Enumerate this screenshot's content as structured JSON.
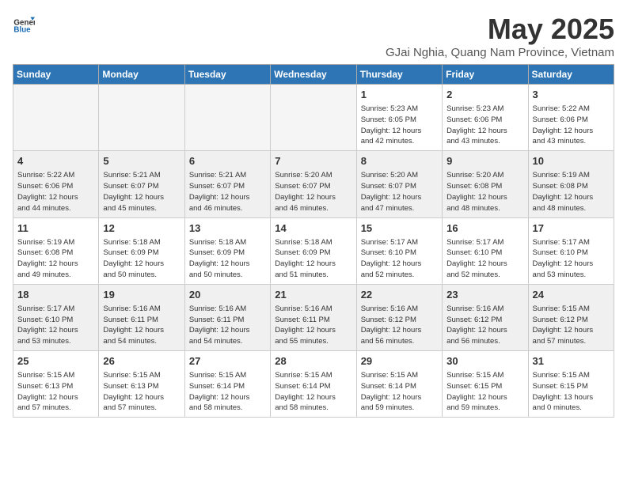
{
  "logo": {
    "general": "General",
    "blue": "Blue"
  },
  "header": {
    "title": "May 2025",
    "subtitle": "GJai Nghia, Quang Nam Province, Vietnam"
  },
  "weekdays": [
    "Sunday",
    "Monday",
    "Tuesday",
    "Wednesday",
    "Thursday",
    "Friday",
    "Saturday"
  ],
  "weeks": [
    [
      {
        "day": "",
        "info": ""
      },
      {
        "day": "",
        "info": ""
      },
      {
        "day": "",
        "info": ""
      },
      {
        "day": "",
        "info": ""
      },
      {
        "day": "1",
        "info": "Sunrise: 5:23 AM\nSunset: 6:05 PM\nDaylight: 12 hours\nand 42 minutes."
      },
      {
        "day": "2",
        "info": "Sunrise: 5:23 AM\nSunset: 6:06 PM\nDaylight: 12 hours\nand 43 minutes."
      },
      {
        "day": "3",
        "info": "Sunrise: 5:22 AM\nSunset: 6:06 PM\nDaylight: 12 hours\nand 43 minutes."
      }
    ],
    [
      {
        "day": "4",
        "info": "Sunrise: 5:22 AM\nSunset: 6:06 PM\nDaylight: 12 hours\nand 44 minutes."
      },
      {
        "day": "5",
        "info": "Sunrise: 5:21 AM\nSunset: 6:07 PM\nDaylight: 12 hours\nand 45 minutes."
      },
      {
        "day": "6",
        "info": "Sunrise: 5:21 AM\nSunset: 6:07 PM\nDaylight: 12 hours\nand 46 minutes."
      },
      {
        "day": "7",
        "info": "Sunrise: 5:20 AM\nSunset: 6:07 PM\nDaylight: 12 hours\nand 46 minutes."
      },
      {
        "day": "8",
        "info": "Sunrise: 5:20 AM\nSunset: 6:07 PM\nDaylight: 12 hours\nand 47 minutes."
      },
      {
        "day": "9",
        "info": "Sunrise: 5:20 AM\nSunset: 6:08 PM\nDaylight: 12 hours\nand 48 minutes."
      },
      {
        "day": "10",
        "info": "Sunrise: 5:19 AM\nSunset: 6:08 PM\nDaylight: 12 hours\nand 48 minutes."
      }
    ],
    [
      {
        "day": "11",
        "info": "Sunrise: 5:19 AM\nSunset: 6:08 PM\nDaylight: 12 hours\nand 49 minutes."
      },
      {
        "day": "12",
        "info": "Sunrise: 5:18 AM\nSunset: 6:09 PM\nDaylight: 12 hours\nand 50 minutes."
      },
      {
        "day": "13",
        "info": "Sunrise: 5:18 AM\nSunset: 6:09 PM\nDaylight: 12 hours\nand 50 minutes."
      },
      {
        "day": "14",
        "info": "Sunrise: 5:18 AM\nSunset: 6:09 PM\nDaylight: 12 hours\nand 51 minutes."
      },
      {
        "day": "15",
        "info": "Sunrise: 5:17 AM\nSunset: 6:10 PM\nDaylight: 12 hours\nand 52 minutes."
      },
      {
        "day": "16",
        "info": "Sunrise: 5:17 AM\nSunset: 6:10 PM\nDaylight: 12 hours\nand 52 minutes."
      },
      {
        "day": "17",
        "info": "Sunrise: 5:17 AM\nSunset: 6:10 PM\nDaylight: 12 hours\nand 53 minutes."
      }
    ],
    [
      {
        "day": "18",
        "info": "Sunrise: 5:17 AM\nSunset: 6:10 PM\nDaylight: 12 hours\nand 53 minutes."
      },
      {
        "day": "19",
        "info": "Sunrise: 5:16 AM\nSunset: 6:11 PM\nDaylight: 12 hours\nand 54 minutes."
      },
      {
        "day": "20",
        "info": "Sunrise: 5:16 AM\nSunset: 6:11 PM\nDaylight: 12 hours\nand 54 minutes."
      },
      {
        "day": "21",
        "info": "Sunrise: 5:16 AM\nSunset: 6:11 PM\nDaylight: 12 hours\nand 55 minutes."
      },
      {
        "day": "22",
        "info": "Sunrise: 5:16 AM\nSunset: 6:12 PM\nDaylight: 12 hours\nand 56 minutes."
      },
      {
        "day": "23",
        "info": "Sunrise: 5:16 AM\nSunset: 6:12 PM\nDaylight: 12 hours\nand 56 minutes."
      },
      {
        "day": "24",
        "info": "Sunrise: 5:15 AM\nSunset: 6:12 PM\nDaylight: 12 hours\nand 57 minutes."
      }
    ],
    [
      {
        "day": "25",
        "info": "Sunrise: 5:15 AM\nSunset: 6:13 PM\nDaylight: 12 hours\nand 57 minutes."
      },
      {
        "day": "26",
        "info": "Sunrise: 5:15 AM\nSunset: 6:13 PM\nDaylight: 12 hours\nand 57 minutes."
      },
      {
        "day": "27",
        "info": "Sunrise: 5:15 AM\nSunset: 6:14 PM\nDaylight: 12 hours\nand 58 minutes."
      },
      {
        "day": "28",
        "info": "Sunrise: 5:15 AM\nSunset: 6:14 PM\nDaylight: 12 hours\nand 58 minutes."
      },
      {
        "day": "29",
        "info": "Sunrise: 5:15 AM\nSunset: 6:14 PM\nDaylight: 12 hours\nand 59 minutes."
      },
      {
        "day": "30",
        "info": "Sunrise: 5:15 AM\nSunset: 6:15 PM\nDaylight: 12 hours\nand 59 minutes."
      },
      {
        "day": "31",
        "info": "Sunrise: 5:15 AM\nSunset: 6:15 PM\nDaylight: 13 hours\nand 0 minutes."
      }
    ]
  ]
}
